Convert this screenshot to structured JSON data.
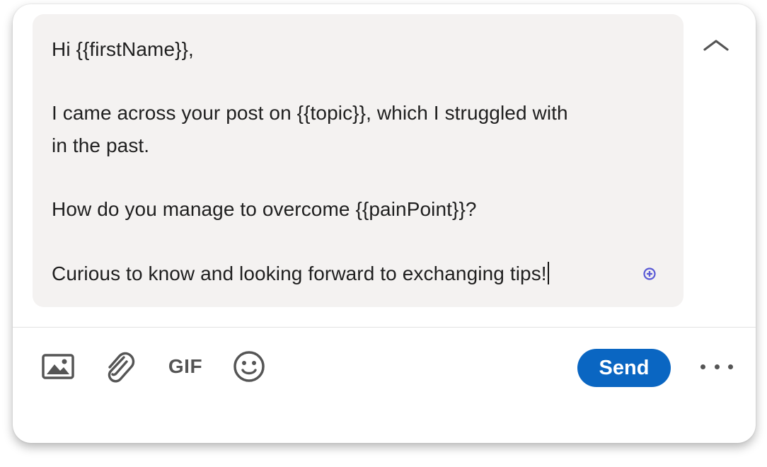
{
  "message": {
    "lines": [
      "Hi {{firstName}},",
      "I came across your post on {{topic}}, which I struggled with",
      "in the past.",
      "How do you manage to overcome {{painPoint}}?",
      "Curious to know and looking forward to exchanging tips!"
    ]
  },
  "toolbar": {
    "gif_label": "GIF",
    "send_label": "Send"
  },
  "colors": {
    "send_button": "#0a66c2",
    "editor_background": "#f4f2f1",
    "inline_plus_icon": "#5b5bd6"
  },
  "icons": [
    "chevron-up-icon",
    "plus-circle-icon",
    "image-icon",
    "paperclip-icon",
    "emoji-icon",
    "more-horizontal-icon"
  ]
}
